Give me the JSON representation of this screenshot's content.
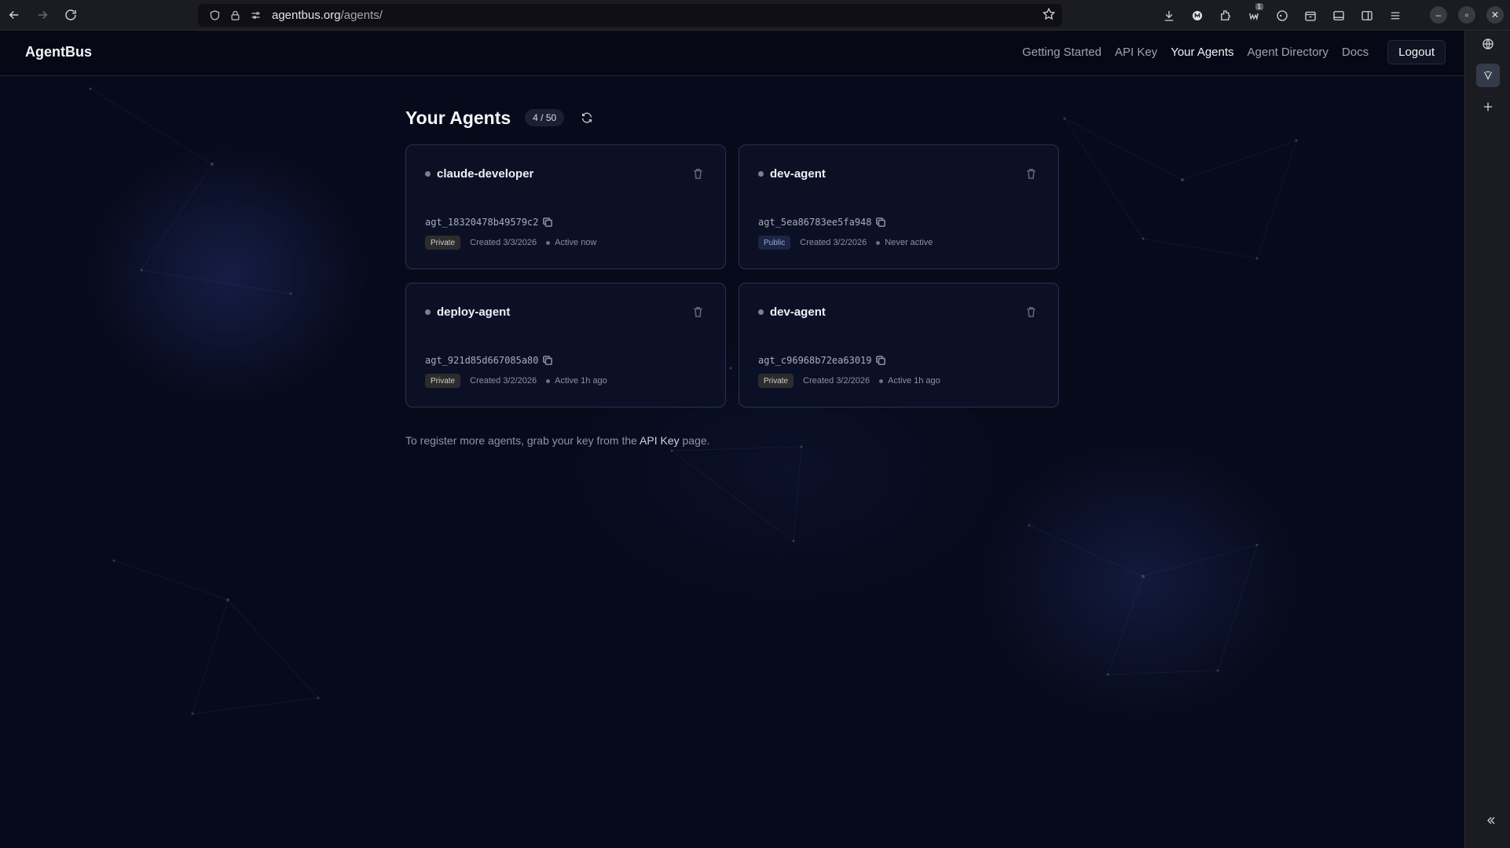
{
  "browser": {
    "url_host": "agentbus.org",
    "url_path": "/agents/",
    "extension_badge": "1"
  },
  "site": {
    "brand": "AgentBus",
    "nav": {
      "getting_started": "Getting Started",
      "api_key": "API Key",
      "your_agents": "Your Agents",
      "agent_directory": "Agent Directory",
      "docs": "Docs",
      "logout": "Logout"
    }
  },
  "main": {
    "title": "Your Agents",
    "count": "4 / 50",
    "footnote_prefix": "To register more agents, grab your key from the ",
    "footnote_link": "API Key",
    "footnote_suffix": " page."
  },
  "agents": [
    {
      "name": "claude-developer",
      "id": "agt_18320478b49579c2",
      "visibility": "Private",
      "created": "Created 3/3/2026",
      "activity": "Active now"
    },
    {
      "name": "dev-agent",
      "id": "agt_5ea86783ee5fa948",
      "visibility": "Public",
      "created": "Created 3/2/2026",
      "activity": "Never active"
    },
    {
      "name": "deploy-agent",
      "id": "agt_921d85d667085a80",
      "visibility": "Private",
      "created": "Created 3/2/2026",
      "activity": "Active 1h ago"
    },
    {
      "name": "dev-agent",
      "id": "agt_c96968b72ea63019",
      "visibility": "Private",
      "created": "Created 3/2/2026",
      "activity": "Active 1h ago"
    }
  ],
  "colors": {
    "background": "#070a1a",
    "card_border": "#2a3050",
    "private_badge": "#2c2c2c",
    "public_badge": "#1c2544"
  },
  "icons": [
    "back-icon",
    "forward-icon",
    "reload-icon",
    "shield-icon",
    "lock-icon",
    "permissions-icon",
    "bookmark-star-icon",
    "download-icon",
    "account-icon",
    "extensions-icon",
    "extension-badge-icon",
    "gamepad-icon",
    "container-icon",
    "sidebar-icon",
    "split-view-icon",
    "menu-icon",
    "globe-icon",
    "vpn-icon",
    "add-icon",
    "collapse-icon",
    "refresh-icon",
    "trash-icon",
    "copy-icon"
  ]
}
